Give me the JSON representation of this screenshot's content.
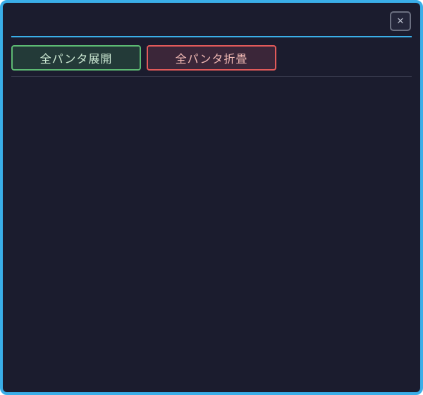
{
  "window": {
    "close_icon": "close-icon",
    "close_glyph": "✕"
  },
  "toolbar": {
    "expand_all_label": "全パンタ展開",
    "collapse_all_label": "全パンタ折畳"
  },
  "colors": {
    "panel_bg": "#1b1c2e",
    "accent_border": "#3aaee8",
    "expand_border": "#5dba73",
    "collapse_border": "#e25a5a"
  }
}
